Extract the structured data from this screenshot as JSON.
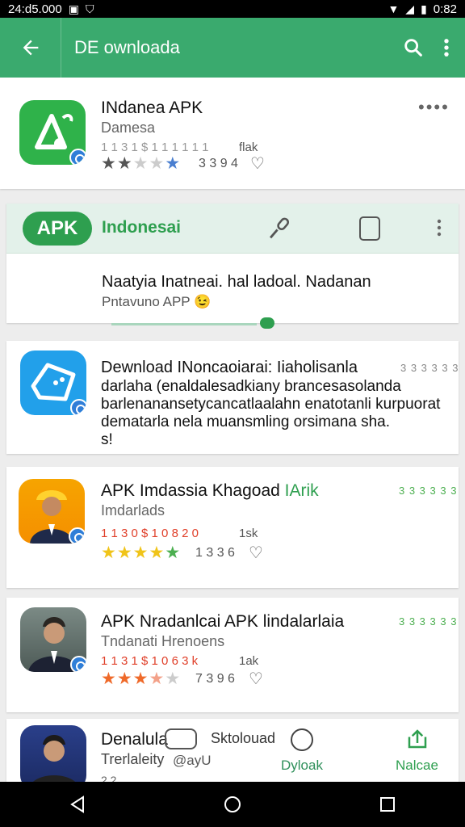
{
  "status": {
    "time_left": "24:d5.000",
    "time_right": "0:82"
  },
  "appbar": {
    "title": "DE ownloada"
  },
  "item1": {
    "name": "INdanea APK",
    "sub": "Damesa",
    "meta_left": "1 1 3 1 $ 1 1 1 1 1 1",
    "meta_right": "flak",
    "count": "3 3 9 4",
    "rating": 2,
    "more": "••••"
  },
  "banner": {
    "badge": "APK",
    "title": "Indonesai",
    "desc": "Naatyia Inatneai. hal ladoal. Nadanan",
    "sub": "Pntavuno APP",
    "emoji": "😉"
  },
  "item2": {
    "title": "Dewnload INoncaoiarai: Iiaholisanla",
    "tag": "3 3 3 3 3 3",
    "lines": [
      "darlaha (enaldalesadkiany brancesasolanda",
      "barlenanansetycancatlaalahn enatotanli kurpuorat",
      "dematarla nela muansmling orsimana sha.",
      "s!"
    ]
  },
  "item3": {
    "name": "APK Imdassia Khagoad",
    "name_green": "IArik",
    "sub": "Imdarlads",
    "meta_left": "1 1 3 0 $ 1 0 8 2 0",
    "meta_right": "1sk",
    "count": "1 3 3 6",
    "tag": "3 3 3 3 3 3",
    "rating": 5
  },
  "item4": {
    "name": "APK Nradanlcai APK lindalarlaia",
    "sub": "Tndanati Hrenoens",
    "meta_left": "1 1 3 1 $ 1 0 6 3 k",
    "meta_right": "1ak",
    "count": "7 3 9 6",
    "tag": "3 3 3 3 3 3",
    "rating": 4
  },
  "item5": {
    "name": "Denalula",
    "sub": "Trerlaleity",
    "action1": "Sktolouad",
    "action1_sub": "@ayU",
    "action2": "Dyloak",
    "action3": "Nalcae",
    "cut_text": "2 2"
  }
}
